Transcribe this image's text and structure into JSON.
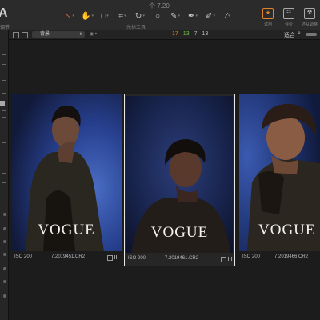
{
  "window": {
    "title": "个 7.20"
  },
  "app": {
    "letter": "A",
    "label": "调节"
  },
  "toolbar": {
    "label": "光标工具",
    "tools": [
      {
        "name": "pointer-tool",
        "glyph": "↖"
      },
      {
        "name": "pan-tool",
        "glyph": "✋"
      },
      {
        "name": "select-tool",
        "glyph": "□"
      },
      {
        "name": "crop-tool",
        "glyph": "⌗"
      },
      {
        "name": "rotate-tool",
        "glyph": "↻"
      },
      {
        "name": "circle-tool",
        "glyph": "○"
      },
      {
        "name": "brush-tool",
        "glyph": "✎"
      },
      {
        "name": "pen-tool",
        "glyph": "✒"
      },
      {
        "name": "eyedropper-tool",
        "glyph": "✐"
      },
      {
        "name": "gradient-tool",
        "glyph": "⁄"
      }
    ]
  },
  "right_tools": [
    {
      "label": "试用",
      "glyph": "★",
      "active": true
    },
    {
      "label": "评价",
      "glyph": "☷",
      "active": false
    },
    {
      "label": "还从调整",
      "glyph": "⚒",
      "active": false
    }
  ],
  "filter": {
    "select_value": "背景",
    "extra": "◉ •",
    "counts": [
      "17",
      "13",
      "7",
      "13"
    ],
    "fit_label": "适合"
  },
  "photos": [
    {
      "wordmark": "VOGUE",
      "iso": "ISO 200",
      "filename": "7.2019451.CR2",
      "selected": false
    },
    {
      "wordmark": "VOGUE",
      "iso": "ISO 200",
      "filename": "7.2019461.CR2",
      "selected": true
    },
    {
      "wordmark": "VOGUE",
      "iso": "ISO 200",
      "filename": "7.2019466.CR2",
      "selected": false
    }
  ],
  "colors": {
    "accent": "#e0832c",
    "green": "#6fc04a",
    "selection_border": "#e8e8e8"
  }
}
